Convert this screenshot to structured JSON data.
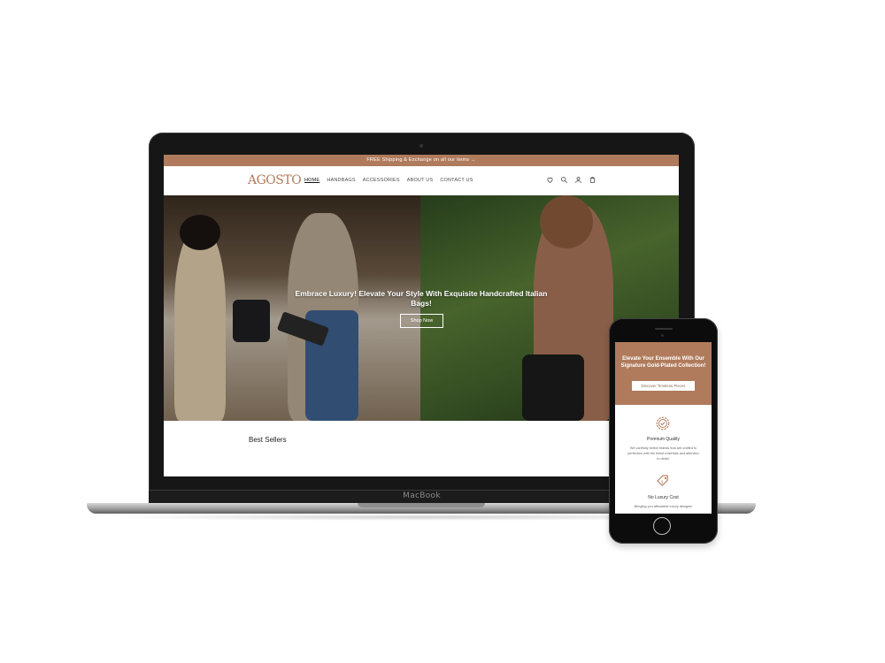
{
  "laptop": {
    "brand_label": "MacBook",
    "site": {
      "announcement": "FREE Shipping & Exchange on all our items →",
      "logo": "AGOSTO",
      "nav": [
        "HOME",
        "HANDBAGS",
        "ACCESSORIES",
        "ABOUT US",
        "CONTACT US"
      ],
      "nav_active": "HOME",
      "header_icons": [
        "heart-icon",
        "search-icon",
        "user-icon",
        "cart-icon"
      ],
      "hero": {
        "title": "Embrace Luxury! Elevate Your Style With Exquisite Handcrafted Italian Bags!",
        "button": "Shop Now"
      },
      "section_title": "Best Sellers"
    }
  },
  "phone": {
    "hero": {
      "title": "Elevate Your Ensemble With Our Signature Gold-Plated Collection!",
      "button": "Discover Timeless Pieces"
    },
    "features": [
      {
        "icon": "badge-check-icon",
        "title": "Premium Quality",
        "text": "We carefully select brands that are crafted to perfection with the finest materials and attention to detail."
      },
      {
        "icon": "price-tag-icon",
        "title": "No Luxury Cost",
        "text": "Bringing you affordable luxury designer"
      }
    ]
  },
  "colors": {
    "brand": "#b07b5c",
    "device_frame": "#161616"
  }
}
